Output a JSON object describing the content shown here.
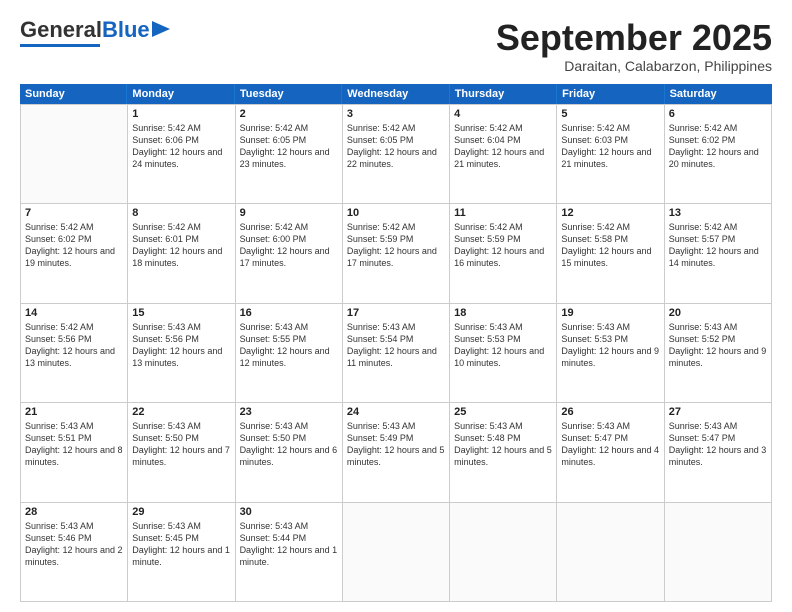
{
  "header": {
    "logo_general": "General",
    "logo_blue": "Blue",
    "month_title": "September 2025",
    "location": "Daraitan, Calabarzon, Philippines"
  },
  "weekdays": [
    "Sunday",
    "Monday",
    "Tuesday",
    "Wednesday",
    "Thursday",
    "Friday",
    "Saturday"
  ],
  "rows": [
    [
      {
        "day": "",
        "sunrise": "",
        "sunset": "",
        "daylight": ""
      },
      {
        "day": "1",
        "sunrise": "Sunrise: 5:42 AM",
        "sunset": "Sunset: 6:06 PM",
        "daylight": "Daylight: 12 hours and 24 minutes."
      },
      {
        "day": "2",
        "sunrise": "Sunrise: 5:42 AM",
        "sunset": "Sunset: 6:05 PM",
        "daylight": "Daylight: 12 hours and 23 minutes."
      },
      {
        "day": "3",
        "sunrise": "Sunrise: 5:42 AM",
        "sunset": "Sunset: 6:05 PM",
        "daylight": "Daylight: 12 hours and 22 minutes."
      },
      {
        "day": "4",
        "sunrise": "Sunrise: 5:42 AM",
        "sunset": "Sunset: 6:04 PM",
        "daylight": "Daylight: 12 hours and 21 minutes."
      },
      {
        "day": "5",
        "sunrise": "Sunrise: 5:42 AM",
        "sunset": "Sunset: 6:03 PM",
        "daylight": "Daylight: 12 hours and 21 minutes."
      },
      {
        "day": "6",
        "sunrise": "Sunrise: 5:42 AM",
        "sunset": "Sunset: 6:02 PM",
        "daylight": "Daylight: 12 hours and 20 minutes."
      }
    ],
    [
      {
        "day": "7",
        "sunrise": "Sunrise: 5:42 AM",
        "sunset": "Sunset: 6:02 PM",
        "daylight": "Daylight: 12 hours and 19 minutes."
      },
      {
        "day": "8",
        "sunrise": "Sunrise: 5:42 AM",
        "sunset": "Sunset: 6:01 PM",
        "daylight": "Daylight: 12 hours and 18 minutes."
      },
      {
        "day": "9",
        "sunrise": "Sunrise: 5:42 AM",
        "sunset": "Sunset: 6:00 PM",
        "daylight": "Daylight: 12 hours and 17 minutes."
      },
      {
        "day": "10",
        "sunrise": "Sunrise: 5:42 AM",
        "sunset": "Sunset: 5:59 PM",
        "daylight": "Daylight: 12 hours and 17 minutes."
      },
      {
        "day": "11",
        "sunrise": "Sunrise: 5:42 AM",
        "sunset": "Sunset: 5:59 PM",
        "daylight": "Daylight: 12 hours and 16 minutes."
      },
      {
        "day": "12",
        "sunrise": "Sunrise: 5:42 AM",
        "sunset": "Sunset: 5:58 PM",
        "daylight": "Daylight: 12 hours and 15 minutes."
      },
      {
        "day": "13",
        "sunrise": "Sunrise: 5:42 AM",
        "sunset": "Sunset: 5:57 PM",
        "daylight": "Daylight: 12 hours and 14 minutes."
      }
    ],
    [
      {
        "day": "14",
        "sunrise": "Sunrise: 5:42 AM",
        "sunset": "Sunset: 5:56 PM",
        "daylight": "Daylight: 12 hours and 13 minutes."
      },
      {
        "day": "15",
        "sunrise": "Sunrise: 5:43 AM",
        "sunset": "Sunset: 5:56 PM",
        "daylight": "Daylight: 12 hours and 13 minutes."
      },
      {
        "day": "16",
        "sunrise": "Sunrise: 5:43 AM",
        "sunset": "Sunset: 5:55 PM",
        "daylight": "Daylight: 12 hours and 12 minutes."
      },
      {
        "day": "17",
        "sunrise": "Sunrise: 5:43 AM",
        "sunset": "Sunset: 5:54 PM",
        "daylight": "Daylight: 12 hours and 11 minutes."
      },
      {
        "day": "18",
        "sunrise": "Sunrise: 5:43 AM",
        "sunset": "Sunset: 5:53 PM",
        "daylight": "Daylight: 12 hours and 10 minutes."
      },
      {
        "day": "19",
        "sunrise": "Sunrise: 5:43 AM",
        "sunset": "Sunset: 5:53 PM",
        "daylight": "Daylight: 12 hours and 9 minutes."
      },
      {
        "day": "20",
        "sunrise": "Sunrise: 5:43 AM",
        "sunset": "Sunset: 5:52 PM",
        "daylight": "Daylight: 12 hours and 9 minutes."
      }
    ],
    [
      {
        "day": "21",
        "sunrise": "Sunrise: 5:43 AM",
        "sunset": "Sunset: 5:51 PM",
        "daylight": "Daylight: 12 hours and 8 minutes."
      },
      {
        "day": "22",
        "sunrise": "Sunrise: 5:43 AM",
        "sunset": "Sunset: 5:50 PM",
        "daylight": "Daylight: 12 hours and 7 minutes."
      },
      {
        "day": "23",
        "sunrise": "Sunrise: 5:43 AM",
        "sunset": "Sunset: 5:50 PM",
        "daylight": "Daylight: 12 hours and 6 minutes."
      },
      {
        "day": "24",
        "sunrise": "Sunrise: 5:43 AM",
        "sunset": "Sunset: 5:49 PM",
        "daylight": "Daylight: 12 hours and 5 minutes."
      },
      {
        "day": "25",
        "sunrise": "Sunrise: 5:43 AM",
        "sunset": "Sunset: 5:48 PM",
        "daylight": "Daylight: 12 hours and 5 minutes."
      },
      {
        "day": "26",
        "sunrise": "Sunrise: 5:43 AM",
        "sunset": "Sunset: 5:47 PM",
        "daylight": "Daylight: 12 hours and 4 minutes."
      },
      {
        "day": "27",
        "sunrise": "Sunrise: 5:43 AM",
        "sunset": "Sunset: 5:47 PM",
        "daylight": "Daylight: 12 hours and 3 minutes."
      }
    ],
    [
      {
        "day": "28",
        "sunrise": "Sunrise: 5:43 AM",
        "sunset": "Sunset: 5:46 PM",
        "daylight": "Daylight: 12 hours and 2 minutes."
      },
      {
        "day": "29",
        "sunrise": "Sunrise: 5:43 AM",
        "sunset": "Sunset: 5:45 PM",
        "daylight": "Daylight: 12 hours and 1 minute."
      },
      {
        "day": "30",
        "sunrise": "Sunrise: 5:43 AM",
        "sunset": "Sunset: 5:44 PM",
        "daylight": "Daylight: 12 hours and 1 minute."
      },
      {
        "day": "",
        "sunrise": "",
        "sunset": "",
        "daylight": ""
      },
      {
        "day": "",
        "sunrise": "",
        "sunset": "",
        "daylight": ""
      },
      {
        "day": "",
        "sunrise": "",
        "sunset": "",
        "daylight": ""
      },
      {
        "day": "",
        "sunrise": "",
        "sunset": "",
        "daylight": ""
      }
    ]
  ]
}
